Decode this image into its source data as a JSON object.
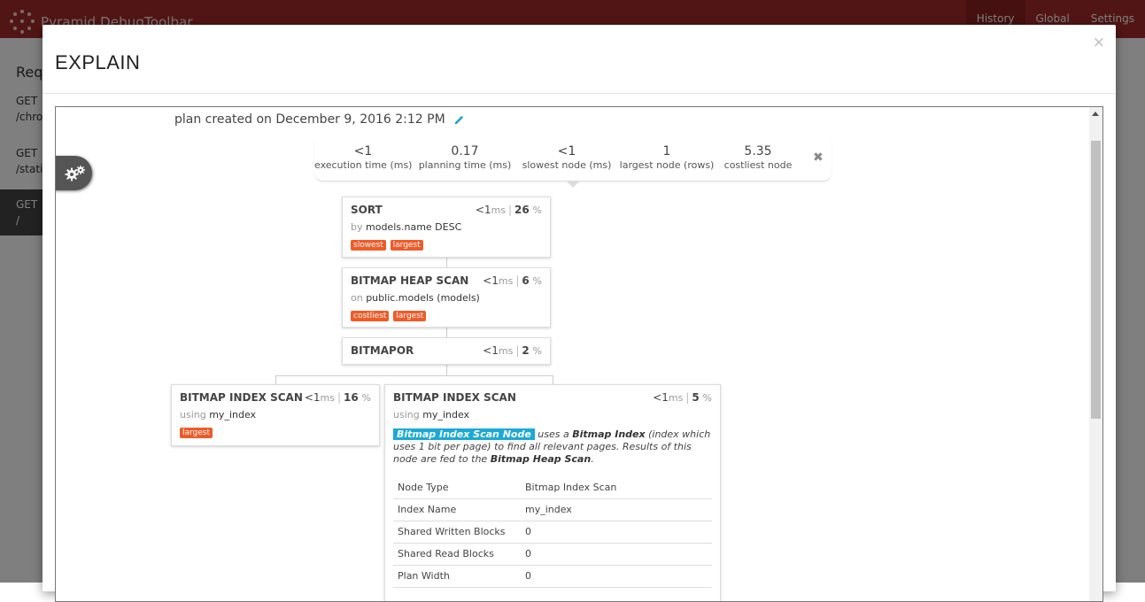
{
  "toolbar": {
    "brand": "Pyramid DebugToolbar",
    "nav": [
      "History",
      "Global",
      "Settings"
    ],
    "active_nav": "History"
  },
  "background": {
    "title": "Req",
    "requests": [
      {
        "method": "GET",
        "path": "/chro"
      },
      {
        "method": "GET",
        "path": "/stati"
      },
      {
        "method": "GET",
        "path": "/"
      }
    ]
  },
  "modal": {
    "title": "EXPLAIN",
    "close": "×"
  },
  "plan": {
    "created_label": "plan created on December 9, 2016 2:12 PM",
    "stats": [
      {
        "value": "<1",
        "label": "execution time (ms)"
      },
      {
        "value": "0.17",
        "label": "planning time (ms)"
      },
      {
        "value": "<1",
        "label": "slowest node (ms)"
      },
      {
        "value": "1",
        "label": "largest node (rows)"
      },
      {
        "value": "5.35",
        "label": "costliest node"
      }
    ],
    "stats_close": "✖",
    "nodes": {
      "sort": {
        "title": "SORT",
        "time": "<1",
        "unit": "ms",
        "pct": "26",
        "pct_unit": "%",
        "sub_kw": "by",
        "sub_val": "models.name DESC",
        "tags": [
          "slowest",
          "largest"
        ]
      },
      "heap": {
        "title": "BITMAP HEAP SCAN",
        "time": "<1",
        "unit": "ms",
        "pct": "6",
        "pct_unit": "%",
        "sub_kw": "on",
        "sub_val": "public.models (models)",
        "tags": [
          "costliest",
          "largest"
        ]
      },
      "bitmapor": {
        "title": "BITMAPOR",
        "time": "<1",
        "unit": "ms",
        "pct": "2",
        "pct_unit": "%"
      },
      "index_left": {
        "title": "BITMAP INDEX SCAN",
        "time": "<1",
        "unit": "ms",
        "pct": "16",
        "pct_unit": "%",
        "sub_kw": "using",
        "sub_val": "my_index",
        "tags": [
          "largest"
        ]
      },
      "index_right": {
        "title": "BITMAP INDEX SCAN",
        "time": "<1",
        "unit": "ms",
        "pct": "5",
        "pct_unit": "%",
        "sub_kw": "using",
        "sub_val": "my_index",
        "desc": {
          "highlight": "Bitmap Index Scan Node",
          "t1": " uses a ",
          "b1": "Bitmap Index",
          "t2": " (index which uses 1 bit per page) to find all relevant pages. Results of this node are fed to the ",
          "b2": "Bitmap Heap Scan",
          "t3": "."
        },
        "props": [
          {
            "key": "Node Type",
            "value": "Bitmap Index Scan"
          },
          {
            "key": "Index Name",
            "value": "my_index"
          },
          {
            "key": "Shared Written Blocks",
            "value": "0"
          },
          {
            "key": "Shared Read Blocks",
            "value": "0"
          },
          {
            "key": "Plan Width",
            "value": "0"
          }
        ]
      }
    }
  },
  "colors": {
    "toolbar": "#a52a2a",
    "tag": "#f05a28",
    "highlight": "#1aa9d6"
  }
}
